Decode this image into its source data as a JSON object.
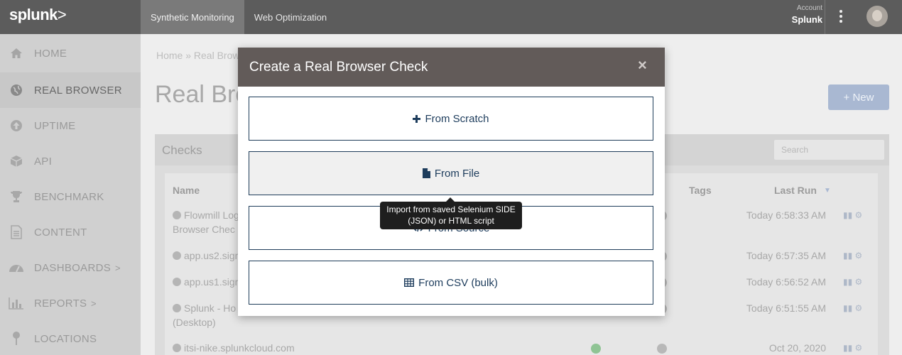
{
  "topbar": {
    "logo": "splunk",
    "logo_chevron": ">",
    "tabs": [
      {
        "label": "Synthetic Monitoring",
        "active": true
      },
      {
        "label": "Web Optimization",
        "active": false
      }
    ],
    "account_label": "Account",
    "account_value": "Splunk"
  },
  "sidebar": {
    "items": [
      {
        "label": "HOME",
        "icon": "home-icon"
      },
      {
        "label": "REAL BROWSER",
        "icon": "globe-icon",
        "active": true
      },
      {
        "label": "UPTIME",
        "icon": "arrow-up-circle-icon"
      },
      {
        "label": "API",
        "icon": "cubes-icon"
      },
      {
        "label": "BENCHMARK",
        "icon": "trophy-icon"
      },
      {
        "label": "CONTENT",
        "icon": "document-icon"
      },
      {
        "label": "DASHBOARDS",
        "icon": "dashboard-icon",
        "arrow": ">"
      },
      {
        "label": "REPORTS",
        "icon": "bar-chart-icon",
        "arrow": ">"
      },
      {
        "label": "LOCATIONS",
        "icon": "map-pin-icon"
      }
    ]
  },
  "main": {
    "breadcrumb": "Home » Real Brow",
    "page_title": "Real Bro",
    "new_button": "+ New",
    "checks_title": "Checks",
    "search_placeholder": "Search",
    "columns": {
      "name": "Name",
      "r": "r",
      "tags": "Tags",
      "last_run": "Last Run"
    },
    "rows": [
      {
        "name_line1": "Flowmill Log",
        "name_line2": "Browser Chec",
        "last_run": "Today 6:58:33 AM"
      },
      {
        "name_line1": "app.us2.sign",
        "name_line2": "",
        "last_run": "Today 6:57:35 AM"
      },
      {
        "name_line1": "app.us1.sign",
        "name_line2": "",
        "last_run": "Today 6:56:52 AM"
      },
      {
        "name_line1": "Splunk - Ho",
        "name_line2": "(Desktop)",
        "last_run": "Today 6:51:55 AM"
      },
      {
        "name_line1": "itsi-nike.splunkcloud.com",
        "name_line2": "",
        "last_run": "Oct 20, 2020"
      }
    ]
  },
  "modal": {
    "title": "Create a Real Browser Check",
    "close": "×",
    "options": [
      {
        "label": "From Scratch",
        "icon": "plus-icon"
      },
      {
        "label": "From File",
        "icon": "file-icon"
      },
      {
        "label": "From Source",
        "icon": "code-icon"
      },
      {
        "label": "From CSV (bulk)",
        "icon": "table-icon"
      }
    ],
    "tooltip_line1": "Import from saved Selenium SIDE",
    "tooltip_line2": "(JSON) or HTML script"
  },
  "colors": {
    "topbar": "#5c5c5c",
    "modal_header": "#625b59",
    "option_border": "#1f3d5a",
    "new_button": "#a9b8d2"
  }
}
